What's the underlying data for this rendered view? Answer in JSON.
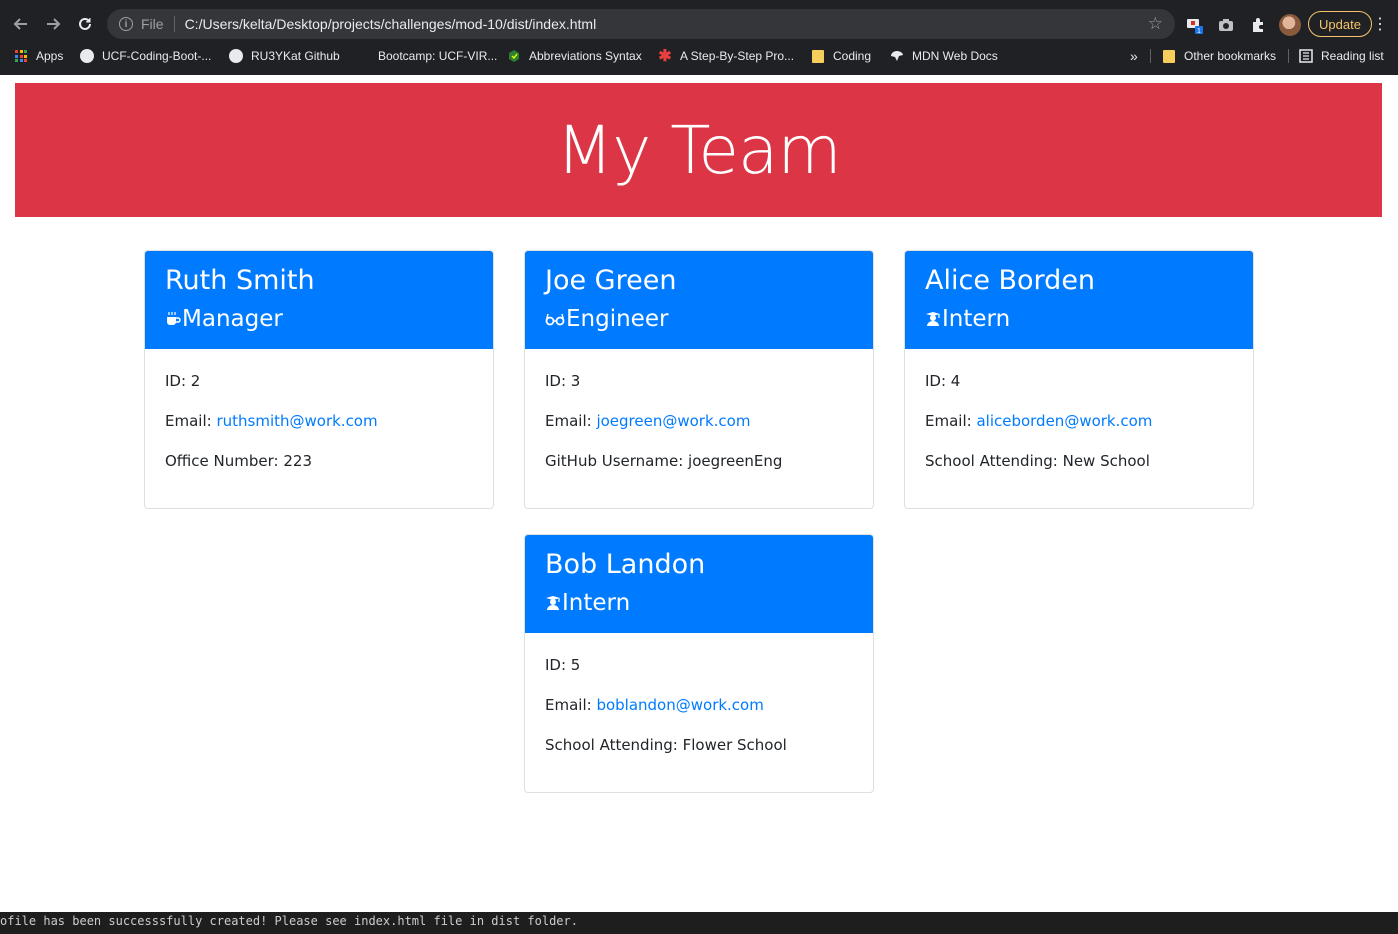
{
  "browser": {
    "scheme_label": "File",
    "url": "C:/Users/kelta/Desktop/projects/challenges/mod-10/dist/index.html",
    "update_label": "Update",
    "extension_badge": "1",
    "bookmarks": [
      {
        "label": "Apps",
        "icon": "apps-grid-icon"
      },
      {
        "label": "UCF-Coding-Boot-...",
        "icon": "github-icon"
      },
      {
        "label": "RU3YKat Github",
        "icon": "github-icon"
      },
      {
        "label": "Bootcamp: UCF-VIR...",
        "icon": "page-icon"
      },
      {
        "label": "Abbreviations Syntax",
        "icon": "extension-icon"
      },
      {
        "label": "A Step-By-Step Pro...",
        "icon": "asterisk-icon"
      },
      {
        "label": "Coding",
        "icon": "folder-icon"
      },
      {
        "label": "MDN Web Docs",
        "icon": "mdn-icon"
      }
    ],
    "overflow_label": "»",
    "other_bookmarks": "Other bookmarks",
    "reading_list": "Reading list"
  },
  "page": {
    "title": "My Team",
    "colors": {
      "header_bg": "#dc3545",
      "card_header_bg": "#007bff",
      "link": "#007bff"
    },
    "cards": [
      {
        "name": "Ruth Smith",
        "role": "Manager",
        "role_icon": "coffee-icon",
        "id_label": "ID: 2",
        "email_label": "Email: ",
        "email": "ruthsmith@work.com",
        "extra": "Office Number: 223"
      },
      {
        "name": "Joe Green",
        "role": "Engineer",
        "role_icon": "glasses-icon",
        "id_label": "ID: 3",
        "email_label": "Email: ",
        "email": "joegreen@work.com",
        "extra": "GitHub Username: joegreenEng"
      },
      {
        "name": "Alice Borden",
        "role": "Intern",
        "role_icon": "graduate-icon",
        "id_label": "ID: 4",
        "email_label": "Email: ",
        "email": "aliceborden@work.com",
        "extra": "School Attending: New School"
      },
      {
        "name": "Bob Landon",
        "role": "Intern",
        "role_icon": "graduate-icon",
        "id_label": "ID: 5",
        "email_label": "Email: ",
        "email": "boblandon@work.com",
        "extra": "School Attending: Flower School"
      }
    ]
  },
  "terminal": {
    "line": "ofile has been successsfully created! Please see index.html file in dist folder."
  }
}
